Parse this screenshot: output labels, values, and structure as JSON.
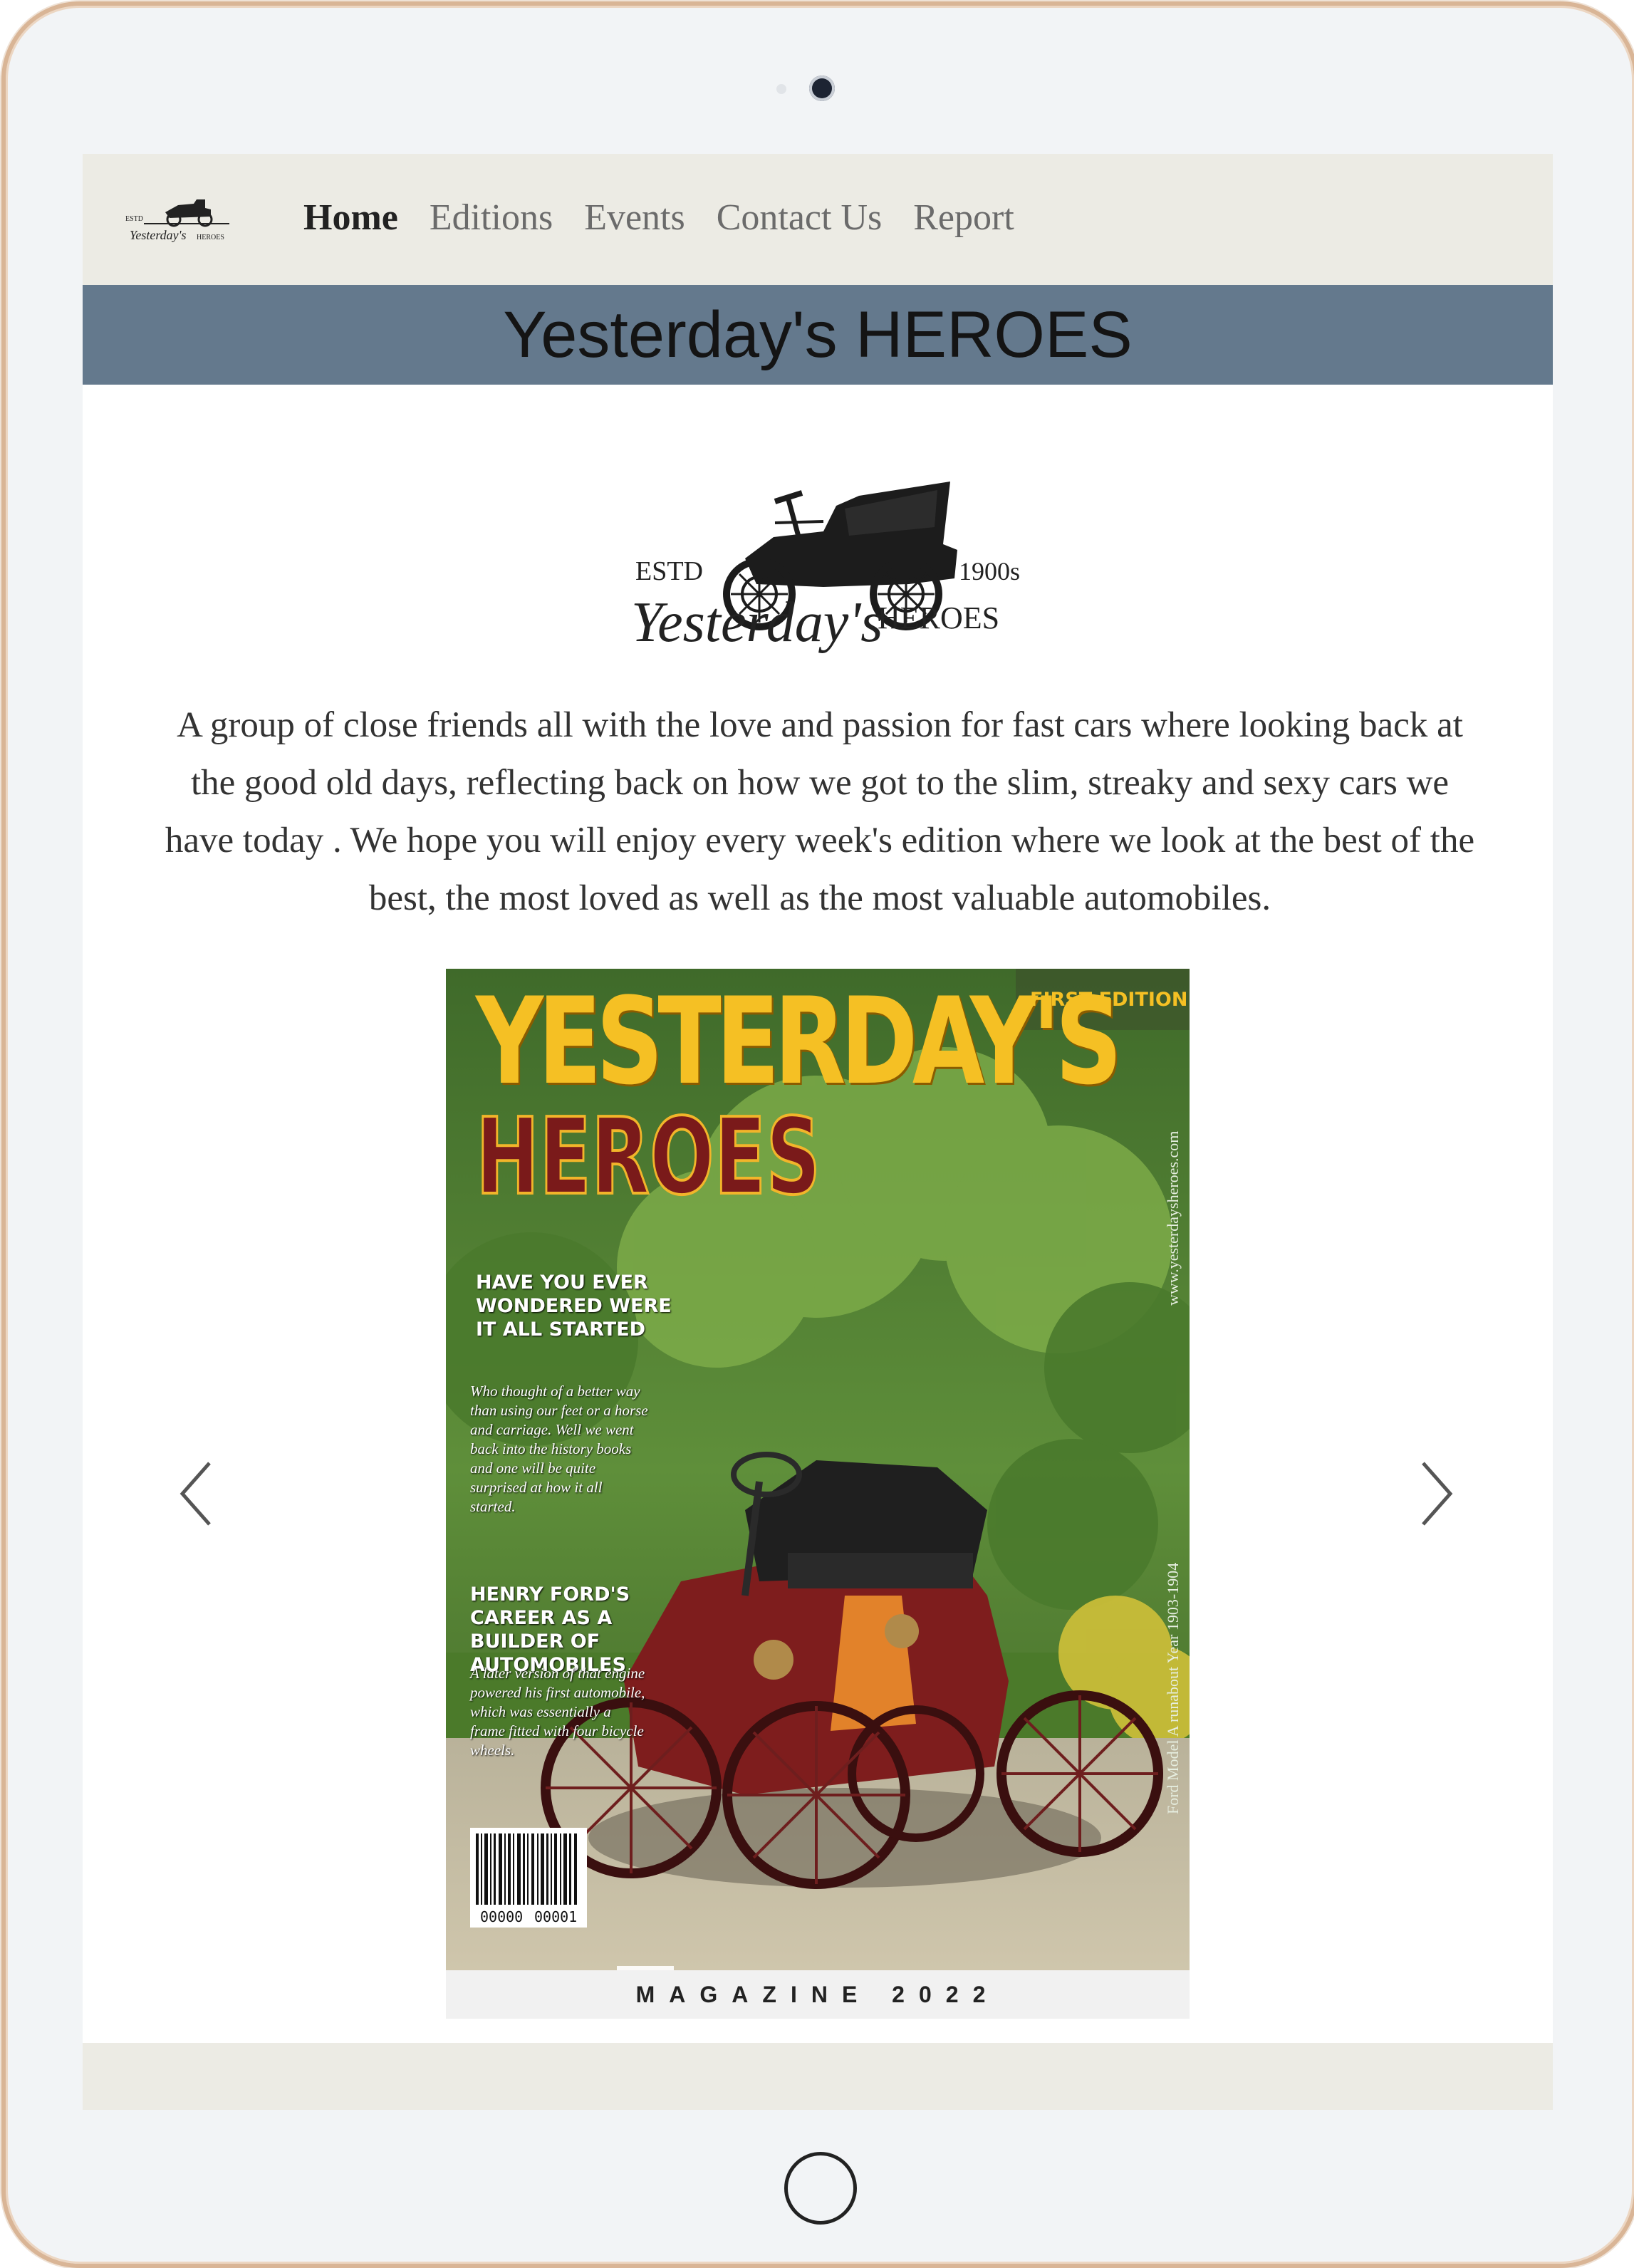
{
  "nav": {
    "items": [
      {
        "label": "Home",
        "active": true
      },
      {
        "label": "Editions",
        "active": false
      },
      {
        "label": "Events",
        "active": false
      },
      {
        "label": "Contact Us",
        "active": false
      },
      {
        "label": "Report",
        "active": false
      }
    ]
  },
  "header": {
    "title": "Yesterday's HEROES"
  },
  "brand": {
    "estd": "ESTD",
    "era": "1900s",
    "script": "Yesterday's",
    "name": "HEROES"
  },
  "intro": "A group of close friends all with the love and passion for fast cars where looking back at the good old days, reflecting back on how we got to the slim, streaky and sexy cars we have today . We hope you will enjoy every week's edition where we look at the best of the best, the most loved as well as the most valuable automobiles.",
  "cover": {
    "title_line1": "YESTERDAY'S",
    "title_line2": "HEROES",
    "badge": "FIRST EDITION",
    "side_text_1": "www.yesterdaysheroes.com",
    "side_text_2": "Ford Model A runabout Year 1903-1904",
    "story1_heading": "HAVE YOU EVER WONDERED WERE IT ALL STARTED",
    "story1_body": "Who thought of a better way than using our feet or a horse and carriage. Well we went back into the history books and one will be quite surprised at how it all started.",
    "story2_heading": "HENRY FORD'S CAREER AS A BUILDER OF AUTOMOBILES",
    "story2_body": "A later version of that engine powered his first automobile, which was essentially a frame fitted with four bicycle wheels.",
    "barcode_left": "00000",
    "barcode_right": "00001",
    "footer": "MAGAZINE 2022"
  },
  "carousel": {
    "prev_icon": "chevron-left-icon",
    "next_icon": "chevron-right-icon"
  },
  "colors": {
    "nav_bg": "#ecebe4",
    "title_band": "#64798d",
    "cover_yellow": "#f5c024",
    "cover_red": "#7a1a1a"
  }
}
